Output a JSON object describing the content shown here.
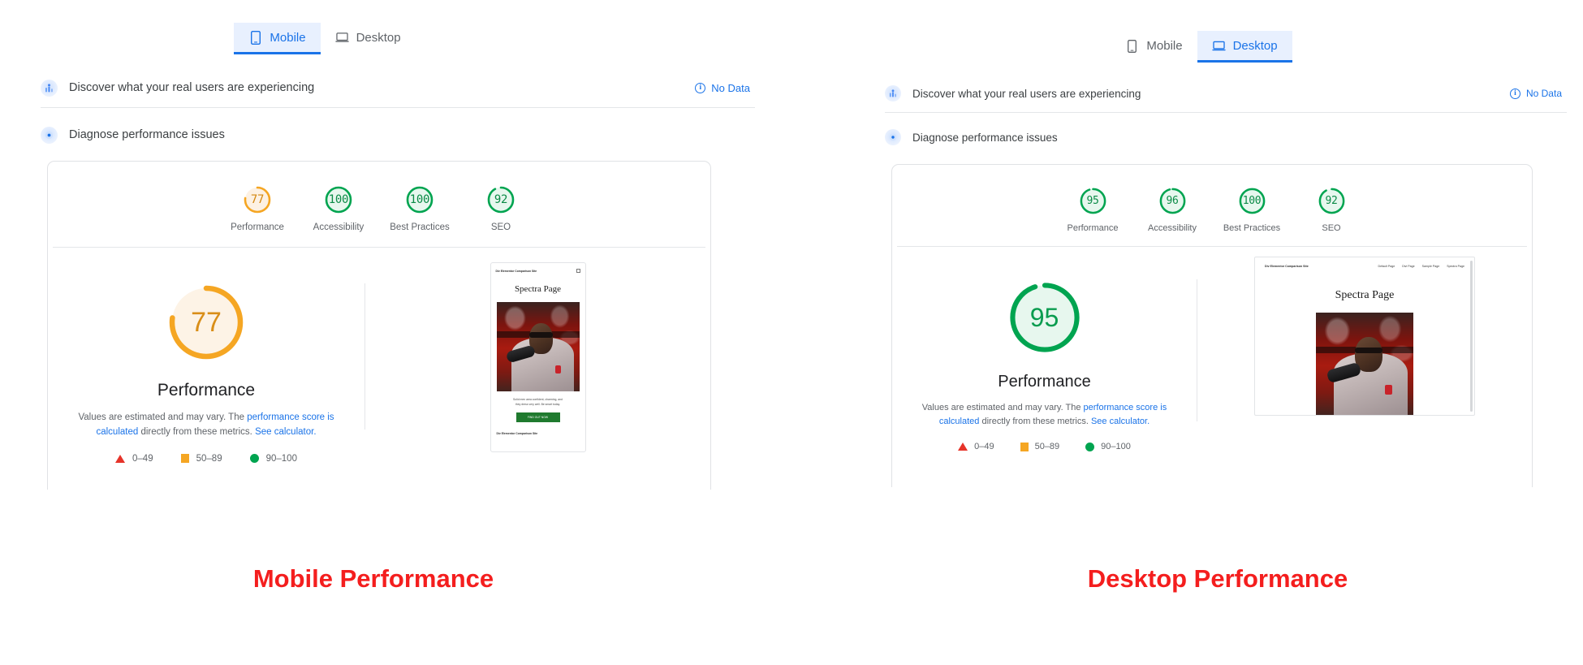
{
  "colors": {
    "accent_blue": "#1a73e8",
    "tab_active_bg": "#e8f0fe",
    "orange": "#f5a623",
    "green": "#00a450",
    "red": "#e63329",
    "caption_red": "#f41e1e",
    "text_secondary": "#5f6368"
  },
  "panels": [
    {
      "id": "mobile",
      "caption": "Mobile Performance",
      "tabs": [
        {
          "label": "Mobile",
          "icon": "mobile-phone-icon",
          "active": true
        },
        {
          "label": "Desktop",
          "icon": "laptop-icon",
          "active": false
        }
      ],
      "field_data": {
        "title": "Discover what your real users are experiencing",
        "icon": "real-user-metrics-icon",
        "status": "No Data",
        "status_icon": "info-icon"
      },
      "lab_data": {
        "title": "Diagnose performance issues",
        "icon": "diagnose-lab-icon"
      },
      "category_scores": [
        {
          "label": "Performance",
          "value": "77",
          "pct": 77,
          "color": "#f5a623",
          "track": "#fdf1e3"
        },
        {
          "label": "Accessibility",
          "value": "100",
          "pct": 100,
          "color": "#00a450",
          "track": "#e7f7ee"
        },
        {
          "label": "Best Practices",
          "value": "100",
          "pct": 100,
          "color": "#00a450",
          "track": "#e7f7ee"
        },
        {
          "label": "SEO",
          "value": "92",
          "pct": 92,
          "color": "#00a450",
          "track": "#e7f7ee"
        }
      ],
      "performance": {
        "value": "77",
        "pct": 77,
        "color": "#f5a623",
        "track": "#fdf1e3",
        "title": "Performance",
        "desc_1": "Values are estimated and may vary. The ",
        "desc_link_1": "performance score is calculated",
        "desc_2": " directly from these metrics. ",
        "desc_link_2": "See calculator."
      },
      "legend": [
        {
          "shape": "triangle",
          "text": "0–49",
          "color": "#e63329"
        },
        {
          "shape": "square",
          "text": "50–89",
          "color": "#f5a623"
        },
        {
          "shape": "circle",
          "text": "90–100",
          "color": "#00a450"
        }
      ],
      "thumbnail": {
        "form_factor": "mobile",
        "brand": "Div Elementor Comparison Site",
        "menu_icon": "hamburger-menu-icon",
        "nav": [],
        "title": "Spectra Page",
        "body_line_1": "Solid men area confident, charming, and",
        "body_line_2": "they dress very well. Be smart today.",
        "cta": "FIND OUT NOW",
        "footer": "Div Elementor Comparison Site"
      }
    },
    {
      "id": "desktop",
      "caption": "Desktop Performance",
      "tabs": [
        {
          "label": "Mobile",
          "icon": "mobile-phone-icon",
          "active": false
        },
        {
          "label": "Desktop",
          "icon": "laptop-icon",
          "active": true
        }
      ],
      "field_data": {
        "title": "Discover what your real users are experiencing",
        "icon": "real-user-metrics-icon",
        "status": "No Data",
        "status_icon": "info-icon"
      },
      "lab_data": {
        "title": "Diagnose performance issues",
        "icon": "diagnose-lab-icon"
      },
      "category_scores": [
        {
          "label": "Performance",
          "value": "95",
          "pct": 95,
          "color": "#00a450",
          "track": "#e7f7ee"
        },
        {
          "label": "Accessibility",
          "value": "96",
          "pct": 96,
          "color": "#00a450",
          "track": "#e7f7ee"
        },
        {
          "label": "Best Practices",
          "value": "100",
          "pct": 100,
          "color": "#00a450",
          "track": "#e7f7ee"
        },
        {
          "label": "SEO",
          "value": "92",
          "pct": 92,
          "color": "#00a450",
          "track": "#e7f7ee"
        }
      ],
      "performance": {
        "value": "95",
        "pct": 95,
        "color": "#00a450",
        "track": "#e7f7ee",
        "title": "Performance",
        "desc_1": "Values are estimated and may vary. The ",
        "desc_link_1": "performance score is calculated",
        "desc_2": " directly from these metrics. ",
        "desc_link_2": "See calculator."
      },
      "legend": [
        {
          "shape": "triangle",
          "text": "0–49",
          "color": "#e63329"
        },
        {
          "shape": "square",
          "text": "50–89",
          "color": "#f5a623"
        },
        {
          "shape": "circle",
          "text": "90–100",
          "color": "#00a450"
        }
      ],
      "thumbnail": {
        "form_factor": "desktop",
        "brand": "Div Elementor Comparison Site",
        "menu_icon": null,
        "nav": [
          "Default Page",
          "Divi Page",
          "Sample Page",
          "Spectra Page"
        ],
        "title": "Spectra Page",
        "body_line_1": "",
        "body_line_2": "",
        "cta": "",
        "footer": ""
      }
    }
  ]
}
